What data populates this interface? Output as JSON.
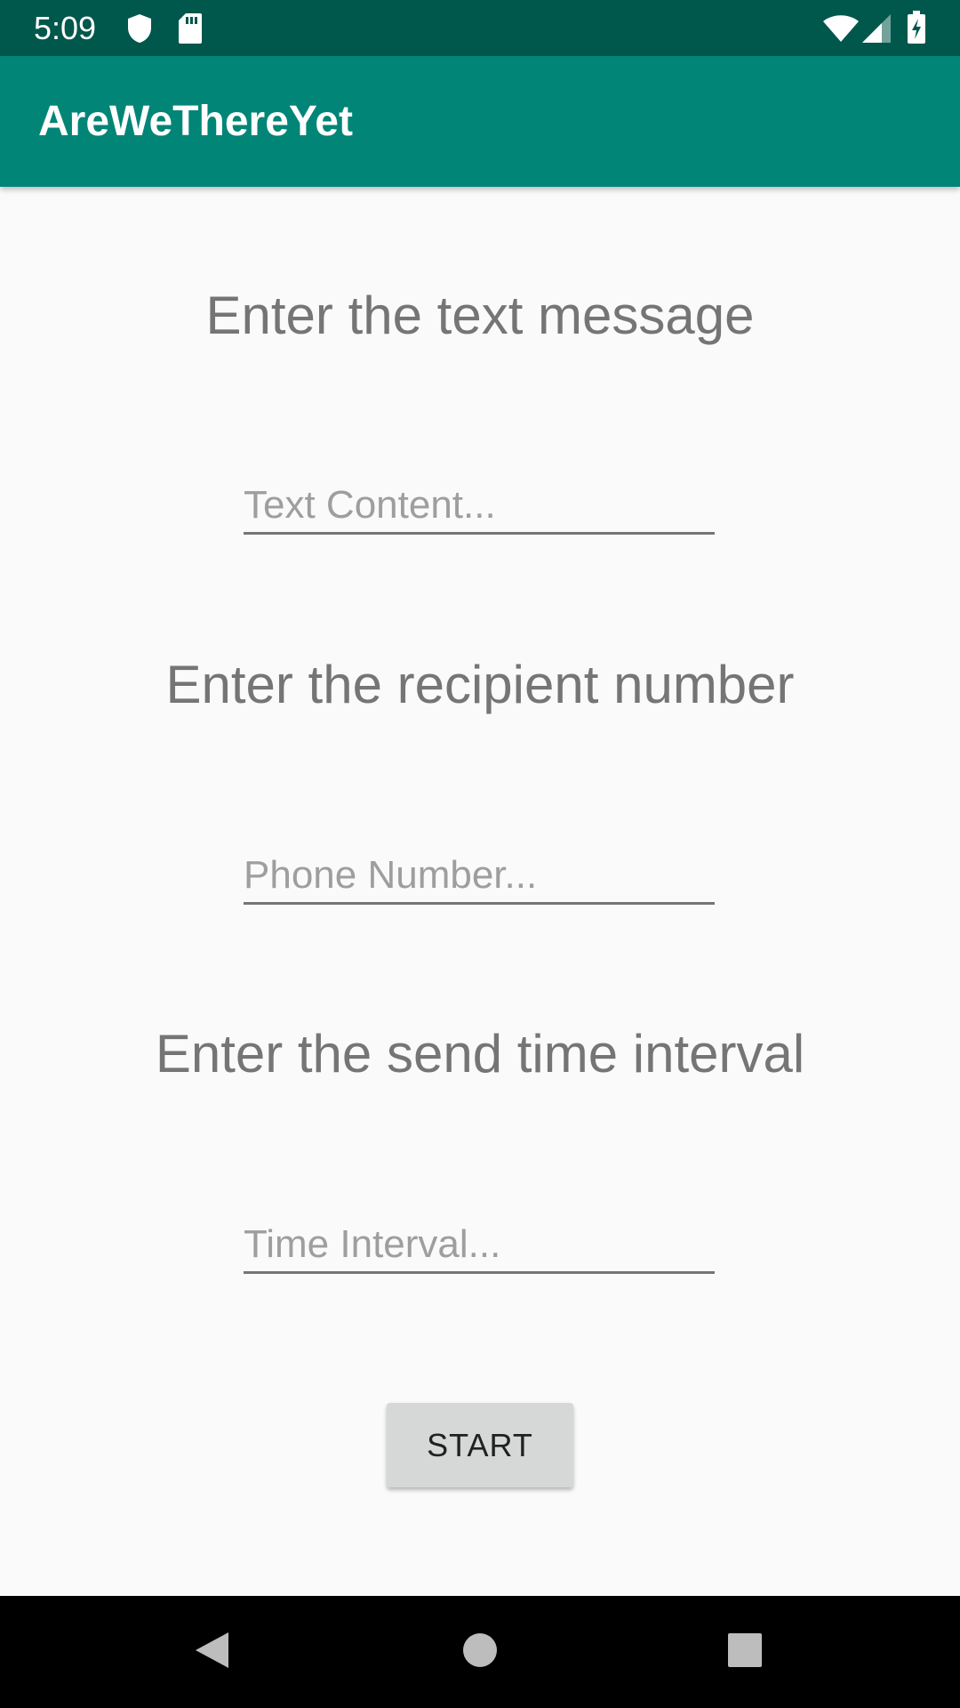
{
  "status_bar": {
    "time": "5:09",
    "icons": [
      "shield-icon",
      "sd-card-icon",
      "wifi-icon",
      "cell-signal-icon",
      "battery-charging-icon"
    ]
  },
  "app_bar": {
    "title": "AreWeThereYet",
    "color": "#008577",
    "status_color": "#00574b"
  },
  "form": {
    "message_heading": "Enter the text message",
    "message_placeholder": "Text Content...",
    "recipient_heading": "Enter the recipient number",
    "recipient_placeholder": "Phone Number...",
    "interval_heading": "Enter the send time interval",
    "interval_placeholder": "Time Interval...",
    "start_label": "START"
  },
  "nav_bar": {
    "icons": [
      "back-icon",
      "home-icon",
      "recents-icon"
    ]
  }
}
